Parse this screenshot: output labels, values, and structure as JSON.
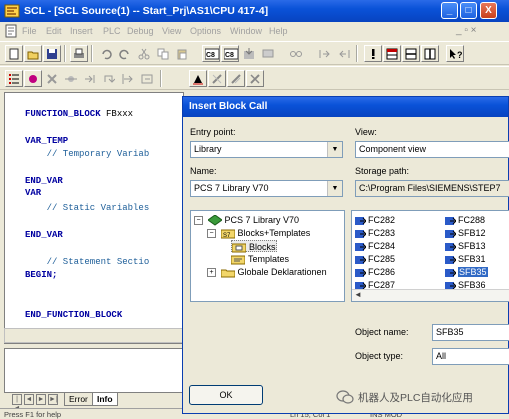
{
  "window": {
    "title": "SCL - [SCL Source(1) -- Start_Prj\\AS1\\CPU 417-4]",
    "controls": {
      "minimize": "_",
      "maximize": "□",
      "close": "X"
    }
  },
  "menu": {
    "items": [
      "File",
      "Edit",
      "Insert",
      "PLC",
      "Debug",
      "View",
      "Options",
      "Window",
      "Help"
    ],
    "mdi_controls": "_ ▫ ×"
  },
  "editor": {
    "lines": [
      {
        "kind": "kw",
        "text": "FUNCTION_BLOCK",
        "rest": " FBxxx"
      },
      {
        "kind": "kw",
        "text": "VAR_TEMP",
        "rest": ""
      },
      {
        "kind": "cm",
        "text": "    // Temporary Variab",
        "rest": ""
      },
      {
        "kind": "kw",
        "text": "END_VAR",
        "rest": ""
      },
      {
        "kind": "kw",
        "text": "VAR",
        "rest": ""
      },
      {
        "kind": "cm",
        "text": "    // Static Variables",
        "rest": ""
      },
      {
        "kind": "kw",
        "text": "END_VAR",
        "rest": ""
      },
      {
        "kind": "cm",
        "text": "    // Statement Sectio",
        "rest": ""
      },
      {
        "kind": "kw",
        "text": "BEGIN;",
        "rest": ""
      },
      {
        "kind": "kw",
        "text": "END_FUNCTION_BLOCK",
        "rest": ""
      }
    ]
  },
  "output_tabs": {
    "error": "Error",
    "info": "Info"
  },
  "statusbar": {
    "left": "Press F1 for help",
    "mid": "Ln 15, Col 1",
    "right": "INS  MOD"
  },
  "dialog": {
    "title": "Insert Block Call",
    "entry_point_label": "Entry point:",
    "entry_point_value": "Library",
    "view_label": "View:",
    "view_value": "Component view",
    "name_label": "Name:",
    "name_value": "PCS 7 Library V70",
    "storage_label": "Storage path:",
    "storage_value": "C:\\Program Files\\SIEMENS\\STEP7",
    "tree": [
      {
        "label": "PCS 7 Library V70",
        "level": 0,
        "expander": "−",
        "icon": "library-icon"
      },
      {
        "label": "Blocks+Templates",
        "level": 1,
        "expander": "−",
        "icon": "program-folder-icon"
      },
      {
        "label": "Blocks",
        "level": 2,
        "expander": "",
        "icon": "blocks-folder-icon",
        "selected": true
      },
      {
        "label": "Templates",
        "level": 2,
        "expander": "",
        "icon": "templates-folder-icon"
      },
      {
        "label": "Globale Deklarationen",
        "level": 1,
        "expander": "+",
        "icon": "folder-icon"
      }
    ],
    "blocks_col1": [
      "FC282",
      "FC283",
      "FC284",
      "FC285",
      "FC286",
      "FC287"
    ],
    "blocks_col2": [
      "FC288",
      "SFB12",
      "SFB13",
      "SFB31",
      "SFB35",
      "SFB36"
    ],
    "selected_block": "SFB35",
    "object_name_label": "Object name:",
    "object_name_value": "SFB35",
    "object_type_label": "Object type:",
    "object_type_value": "All",
    "ok_label": "OK"
  },
  "watermark": {
    "text": "机器人及PLC自动化应用"
  }
}
